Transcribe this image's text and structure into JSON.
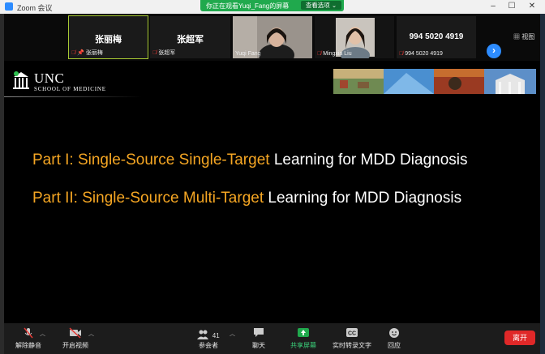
{
  "window": {
    "title": "Zoom 会议",
    "share_banner": "你正在观看Yuqi_Fang的屏幕",
    "view_options": "查看选项 ⌄",
    "buttons": {
      "minimize": "–",
      "maximize": "☐",
      "close": "✕"
    }
  },
  "participants": [
    {
      "display_name": "张丽梅",
      "label": "张丽梅",
      "muted": true,
      "pinned": true,
      "active": true
    },
    {
      "display_name": "张超军",
      "label": "张超军",
      "muted": true
    },
    {
      "display_name": "",
      "label": "Yuqi Fang",
      "muted": false,
      "video": true
    },
    {
      "display_name": "",
      "label": "Mingxia Liu",
      "muted": true,
      "video": true
    },
    {
      "display_name": "994 5020 4919",
      "label": "994 5020 4919",
      "muted": true
    }
  ],
  "view_label": "视图",
  "next_page": "›",
  "slide": {
    "institution": "UNC",
    "school": "SCHOOL OF MEDICINE",
    "lines": [
      {
        "highlight": "Part I: Single-Source Single-Target",
        "rest": " Learning for MDD Diagnosis"
      },
      {
        "highlight": "Part II: Single-Source Multi-Target",
        "rest": " Learning for MDD Diagnosis"
      }
    ]
  },
  "toolbar": {
    "mute": "解除静音",
    "video": "开启视频",
    "participants": "参会者",
    "participants_count": "41",
    "chat": "聊天",
    "share": "共享屏幕",
    "transcript": "实时转录文字",
    "reactions": "回应",
    "leave": "离开"
  },
  "colors": {
    "highlight": "#f5a623",
    "share_green": "#20a94d",
    "leave_red": "#e02828",
    "mute_red": "#e53935"
  }
}
